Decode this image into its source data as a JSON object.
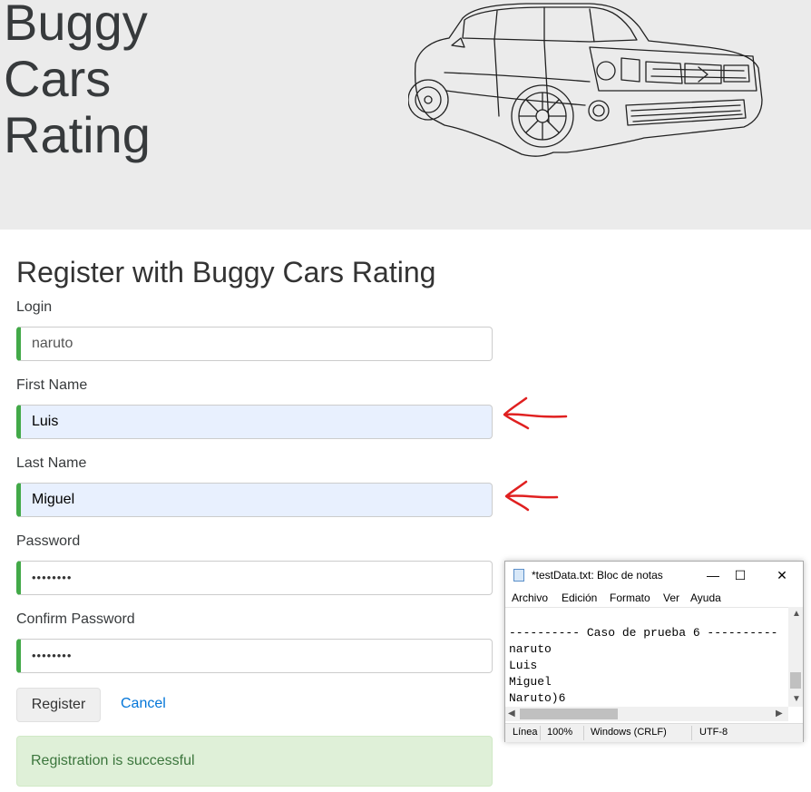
{
  "header": {
    "brand": "Buggy\nCars\nRating"
  },
  "form": {
    "title": "Register with Buggy Cars Rating",
    "login_label": "Login",
    "login_value": "naruto",
    "first_name_label": "First Name",
    "first_name_value": "Luis",
    "last_name_label": "Last Name",
    "last_name_value": "Miguel",
    "password_label": "Password",
    "password_value": "••••••••",
    "confirm_password_label": "Confirm Password",
    "confirm_password_value": "••••••••",
    "register_label": "Register",
    "cancel_label": "Cancel",
    "success_message": "Registration is successful"
  },
  "annotation_color": "#e02020",
  "valid_border_color": "#42a948",
  "notepad": {
    "title": "*testData.txt: Bloc de notas",
    "controls": {
      "minimize": "—",
      "maximize": "☐",
      "close": "✕"
    },
    "menu": [
      "Archivo",
      "Edición",
      "Formato",
      "Ver",
      "Ayuda"
    ],
    "lines": [
      "",
      "---------- Caso de prueba 6 ----------",
      "naruto",
      "Luis",
      "Miguel",
      "Naruto)6"
    ],
    "status": {
      "position": "Línea",
      "zoom": "100%",
      "line_ending": "Windows (CRLF)",
      "encoding": "UTF-8"
    }
  }
}
